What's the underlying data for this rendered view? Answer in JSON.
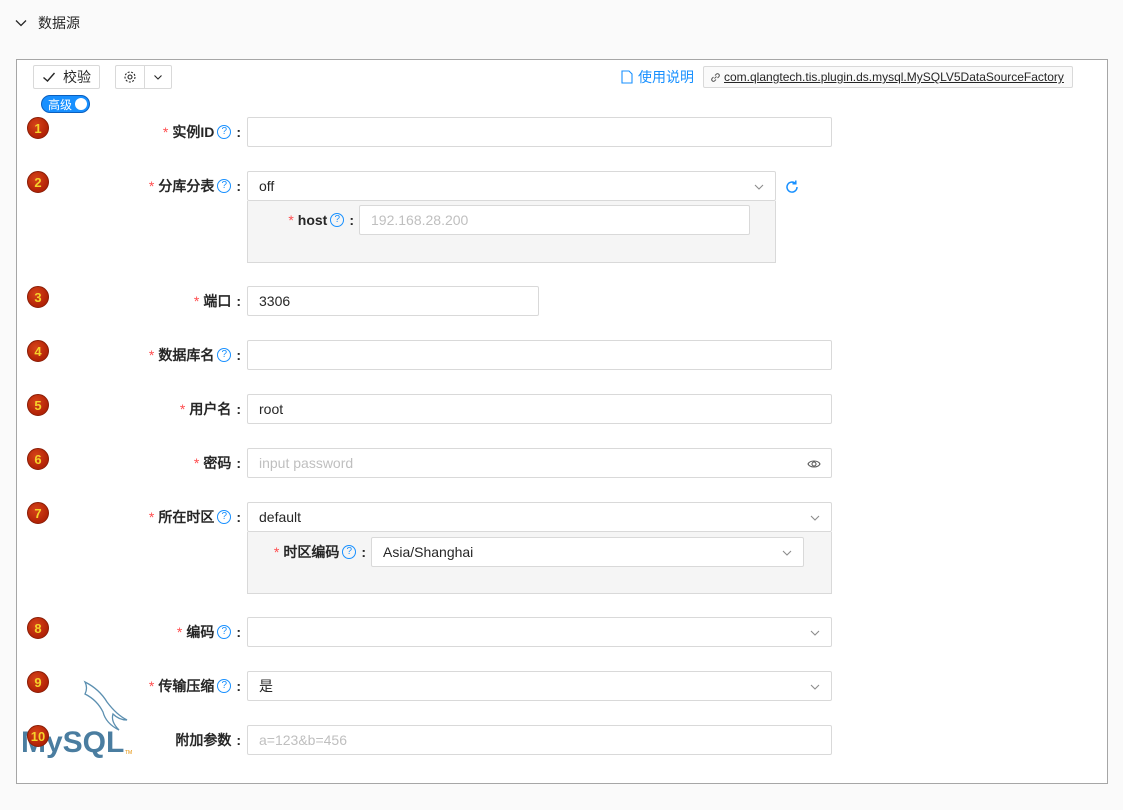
{
  "section": {
    "title": "数据源"
  },
  "toolbar": {
    "check_label": "校验",
    "advanced_toggle": "高级",
    "doc_link": "使用说明",
    "plugin_class": "com.qlangtech.tis.plugin.ds.mysql.MySQLV5DataSourceFactory"
  },
  "fields": [
    {
      "num": "1",
      "label": "实例ID",
      "required": "*",
      "help": "?",
      "value": "",
      "placeholder": ""
    },
    {
      "num": "2",
      "label": "分库分表",
      "required": "*",
      "help": "?",
      "value": "off",
      "placeholder": ""
    },
    {
      "num": "3",
      "label": "端口",
      "required": "*",
      "value": "3306",
      "placeholder": ""
    },
    {
      "num": "4",
      "label": "数据库名",
      "required": "*",
      "help": "?",
      "value": "",
      "placeholder": ""
    },
    {
      "num": "5",
      "label": "用户名",
      "required": "*",
      "value": "root",
      "placeholder": ""
    },
    {
      "num": "6",
      "label": "密码",
      "required": "*",
      "value": "",
      "placeholder": "input password"
    },
    {
      "num": "7",
      "label": "所在时区",
      "required": "*",
      "help": "?",
      "value": "default",
      "placeholder": ""
    },
    {
      "num": "8",
      "label": "编码",
      "required": "*",
      "help": "?",
      "value": "",
      "placeholder": ""
    },
    {
      "num": "9",
      "label": "传输压缩",
      "required": "*",
      "help": "?",
      "value": "是",
      "placeholder": ""
    },
    {
      "num": "10",
      "label": "附加参数",
      "value": "",
      "placeholder": "a=123&b=456"
    }
  ],
  "subfields": {
    "host": {
      "label": "host",
      "required": "*",
      "help": "?",
      "placeholder": "192.168.28.200"
    },
    "timezone_code": {
      "label": "时区编码",
      "required": "*",
      "help": "?",
      "value": "Asia/Shanghai"
    }
  },
  "colon": ":",
  "logo": {
    "text": "MySQL",
    "tm": "TM"
  },
  "colors": {
    "accent": "#1890ff",
    "required": "#ff4d4f",
    "badge": "#c0280a",
    "badge_text": "#f5d32a"
  }
}
